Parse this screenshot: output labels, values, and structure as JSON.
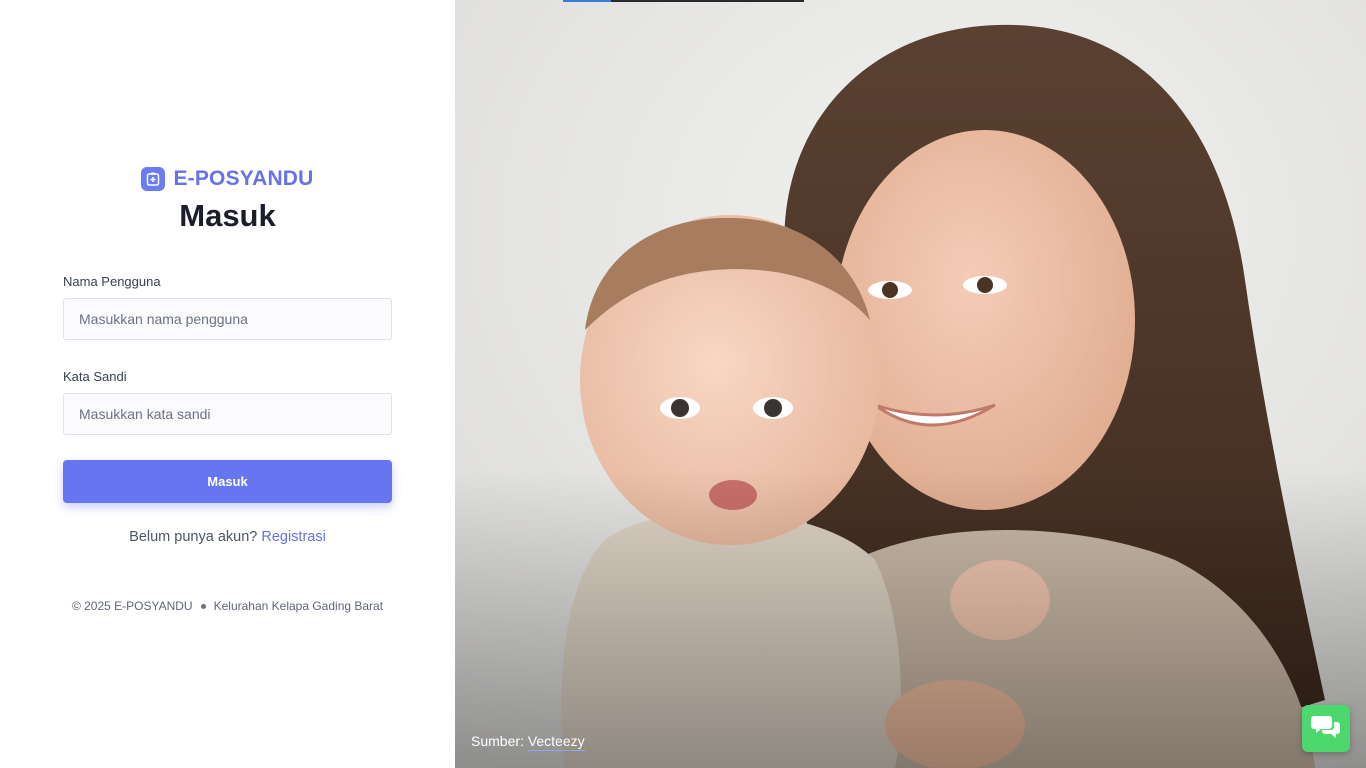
{
  "brand": {
    "name": "E-POSYANDU",
    "logo_icon": "hospital-building-icon"
  },
  "page": {
    "title": "Masuk"
  },
  "form": {
    "username": {
      "label": "Nama Pengguna",
      "placeholder": "Masukkan nama pengguna",
      "value": ""
    },
    "password": {
      "label": "Kata Sandi",
      "placeholder": "Masukkan kata sandi",
      "value": ""
    },
    "submit_label": "Masuk"
  },
  "register": {
    "prompt": "Belum punya akun?",
    "link_label": "Registrasi"
  },
  "footer": {
    "copyright": "© 2025 E-POSYANDU",
    "location": "Kelurahan Kelapa Gading Barat"
  },
  "hero": {
    "image": "photo of smiling mother holding a baby",
    "credit_prefix": "Sumber:",
    "credit_link": "Vecteezy"
  },
  "chat_widget": {
    "icon": "chat-bubbles-icon",
    "color": "#4dd86e"
  },
  "colors": {
    "accent": "#6875f0",
    "brand_text": "#6672e6",
    "chat": "#4dd86e"
  }
}
